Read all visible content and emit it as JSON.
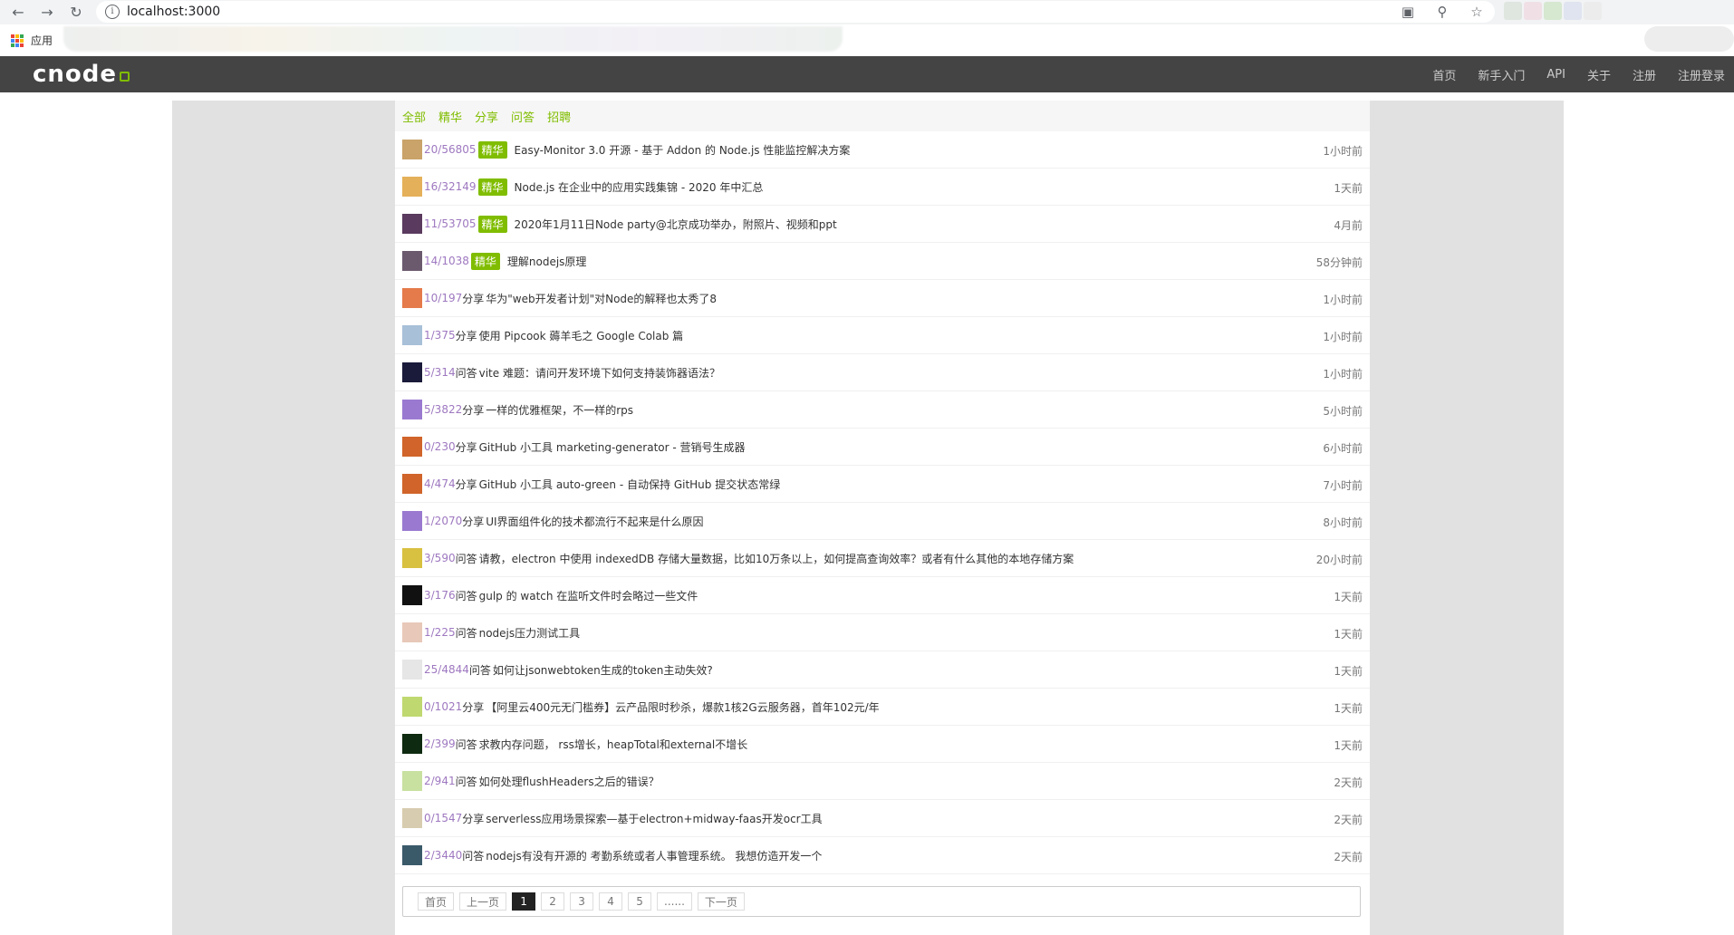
{
  "browser": {
    "url": "localhost:3000",
    "bookmarks_label": "应用"
  },
  "site": {
    "brand": "cnode",
    "nav": [
      "首页",
      "新手入门",
      "API",
      "关于",
      "注册",
      "注册登录"
    ]
  },
  "tabs": [
    "全部",
    "精华",
    "分享",
    "问答",
    "招聘"
  ],
  "topics": [
    {
      "count": "20/56805",
      "good": "精华",
      "tab": "",
      "title": "Easy-Monitor 3.0 开源 - 基于 Addon 的 Node.js 性能监控解决方案",
      "time": "1小时前",
      "avatar_color": "#c9a36a"
    },
    {
      "count": "16/32149",
      "good": "精华",
      "tab": "",
      "title": "Node.js 在企业中的应用实践集锦 - 2020 年中汇总",
      "time": "1天前",
      "avatar_color": "#e5b05a"
    },
    {
      "count": "11/53705",
      "good": "精华",
      "tab": "",
      "title": "2020年1月11日Node party@北京成功举办，附照片、视频和ppt",
      "time": "4月前",
      "avatar_color": "#5a3a5e"
    },
    {
      "count": "14/1038",
      "good": "精华",
      "tab": "",
      "title": "理解nodejs原理",
      "time": "58分钟前",
      "avatar_color": "#6b5a6e"
    },
    {
      "count": "10/197",
      "good": "",
      "tab": "分享",
      "title": "华为\"web开发者计划\"对Node的解释也太秀了8",
      "time": "1小时前",
      "avatar_color": "#e57a4a"
    },
    {
      "count": "1/375",
      "good": "",
      "tab": "分享",
      "title": "使用 Pipcook 薅羊毛之 Google Colab 篇",
      "time": "1小时前",
      "avatar_color": "#a8c0d8"
    },
    {
      "count": "5/314",
      "good": "",
      "tab": "问答",
      "title": "vite 难题：请问开发环境下如何支持装饰器语法？",
      "time": "1小时前",
      "avatar_color": "#1a1a3a"
    },
    {
      "count": "5/3822",
      "good": "",
      "tab": "分享",
      "title": "一样的优雅框架，不一样的rps",
      "time": "5小时前",
      "avatar_color": "#9a7ad0"
    },
    {
      "count": "0/230",
      "good": "",
      "tab": "分享",
      "title": "GitHub 小工具 marketing-generator - 营销号生成器",
      "time": "6小时前",
      "avatar_color": "#d0642a"
    },
    {
      "count": "4/474",
      "good": "",
      "tab": "分享",
      "title": "GitHub 小工具 auto-green - 自动保持 GitHub 提交状态常绿",
      "time": "7小时前",
      "avatar_color": "#d0642a"
    },
    {
      "count": "1/2070",
      "good": "",
      "tab": "分享",
      "title": "UI界面组件化的技术都流行不起来是什么原因",
      "time": "8小时前",
      "avatar_color": "#9a7ad0"
    },
    {
      "count": "3/590",
      "good": "",
      "tab": "问答",
      "title": "请教，electron 中使用 indexedDB 存储大量数据，比如10万条以上，如何提高查询效率？或者有什么其他的本地存储方案",
      "time": "20小时前",
      "avatar_color": "#d8c040"
    },
    {
      "count": "3/176",
      "good": "",
      "tab": "问答",
      "title": "gulp 的 watch 在监听文件时会略过一些文件",
      "time": "1天前",
      "avatar_color": "#111111"
    },
    {
      "count": "1/225",
      "good": "",
      "tab": "问答",
      "title": "nodejs压力测试工具",
      "time": "1天前",
      "avatar_color": "#e8c8b8"
    },
    {
      "count": "25/4844",
      "good": "",
      "tab": "问答",
      "title": "如何让jsonwebtoken生成的token主动失效?",
      "time": "1天前",
      "avatar_color": "#e6e6e6"
    },
    {
      "count": "0/1021",
      "good": "",
      "tab": "分享",
      "title": "【阿里云400元无门槛券】云产品限时秒杀，爆款1核2G云服务器，首年102元/年",
      "time": "1天前",
      "avatar_color": "#c0d870"
    },
    {
      "count": "2/399",
      "good": "",
      "tab": "问答",
      "title": "求教内存问题， rss增长，heapTotal和external不增长",
      "time": "1天前",
      "avatar_color": "#0e2a10"
    },
    {
      "count": "2/941",
      "good": "",
      "tab": "问答",
      "title": "如何处理flushHeaders之后的错误？",
      "time": "2天前",
      "avatar_color": "#c8e0a0"
    },
    {
      "count": "0/1547",
      "good": "",
      "tab": "分享",
      "title": "serverless应用场景探索—基于electron+midway-faas开发ocr工具",
      "time": "2天前",
      "avatar_color": "#d8ccb0"
    },
    {
      "count": "2/3440",
      "good": "",
      "tab": "问答",
      "title": "nodejs有没有开源的 考勤系统或者人事管理系统。 我想仿造开发一个",
      "time": "2天前",
      "avatar_color": "#3a5a6a"
    }
  ],
  "pagination": [
    "首页",
    "上一页",
    "1",
    "2",
    "3",
    "4",
    "5",
    "......",
    "下一页"
  ],
  "pagination_active": "1"
}
